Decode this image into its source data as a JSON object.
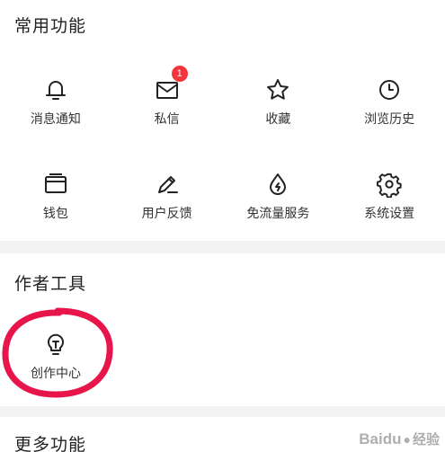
{
  "sections": {
    "common": {
      "title": "常用功能",
      "items": [
        {
          "label": "消息通知",
          "icon": "bell-icon"
        },
        {
          "label": "私信",
          "icon": "mail-icon",
          "badge": "1"
        },
        {
          "label": "收藏",
          "icon": "star-icon"
        },
        {
          "label": "浏览历史",
          "icon": "clock-icon"
        },
        {
          "label": "钱包",
          "icon": "wallet-icon"
        },
        {
          "label": "用户反馈",
          "icon": "pen-icon"
        },
        {
          "label": "免流量服务",
          "icon": "drop-icon"
        },
        {
          "label": "系统设置",
          "icon": "gear-icon"
        }
      ]
    },
    "author": {
      "title": "作者工具",
      "items": [
        {
          "label": "创作中心",
          "icon": "lightbulb-icon"
        }
      ]
    },
    "more": {
      "title": "更多功能"
    }
  },
  "watermark": {
    "brand": "Baidu",
    "suffix": "经验"
  },
  "colors": {
    "badge": "#f2363b",
    "highlight": "#e8154a",
    "divider": "#f3f3f3"
  }
}
